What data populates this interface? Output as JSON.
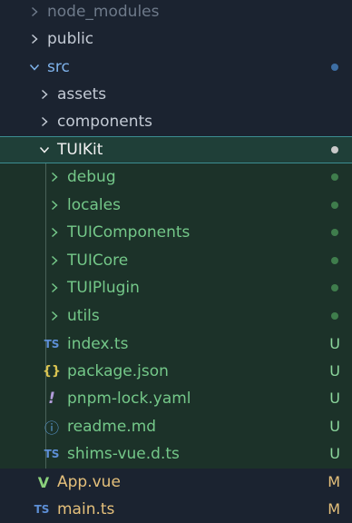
{
  "colors": {
    "background": "#1b2330",
    "modified_section_bg": "#1c3229",
    "selected_row_bg": "#1f3f38",
    "selection_border": "#3c8e92",
    "text_dim": "#6e7a8a",
    "text_normal": "#c3cad4",
    "text_blue": "#7fb3ec",
    "text_green": "#74c889",
    "text_white": "#f2f2f2",
    "dot_blue": "#3d6ea4",
    "dot_green": "#3f7d4c",
    "dot_white": "#c9c9c9",
    "ts_blue": "#5d8fd6",
    "json_yellow": "#d9c451",
    "yaml_purple": "#b19cd9",
    "info_blue": "#5b9bd5",
    "vue_green": "#8bd17c",
    "badge_u": "#8cd79d",
    "badge_m": "#e5c07b"
  },
  "explorer": {
    "items": [
      {
        "label": "node_modules",
        "kind": "folder",
        "expanded": false
      },
      {
        "label": "public",
        "kind": "folder",
        "expanded": false
      },
      {
        "label": "src",
        "kind": "folder",
        "expanded": true,
        "status": "dot"
      },
      {
        "label": "assets",
        "kind": "folder",
        "expanded": false
      },
      {
        "label": "components",
        "kind": "folder",
        "expanded": false
      },
      {
        "label": "TUIKit",
        "kind": "folder",
        "expanded": true,
        "selected": true,
        "status": "dot"
      },
      {
        "label": "debug",
        "kind": "folder",
        "expanded": false,
        "status": "dot"
      },
      {
        "label": "locales",
        "kind": "folder",
        "expanded": false,
        "status": "dot"
      },
      {
        "label": "TUIComponents",
        "kind": "folder",
        "expanded": false,
        "status": "dot"
      },
      {
        "label": "TUICore",
        "kind": "folder",
        "expanded": false,
        "status": "dot"
      },
      {
        "label": "TUIPlugin",
        "kind": "folder",
        "expanded": false,
        "status": "dot"
      },
      {
        "label": "utils",
        "kind": "folder",
        "expanded": false,
        "status": "dot"
      },
      {
        "label": "index.ts",
        "kind": "file",
        "icon": "TS",
        "status": "U"
      },
      {
        "label": "package.json",
        "kind": "file",
        "icon": "{}",
        "status": "U"
      },
      {
        "label": "pnpm-lock.yaml",
        "kind": "file",
        "icon": "!",
        "status": "U"
      },
      {
        "label": "readme.md",
        "kind": "file",
        "icon": "ⓘ",
        "status": "U"
      },
      {
        "label": "shims-vue.d.ts",
        "kind": "file",
        "icon": "TS",
        "status": "U"
      },
      {
        "label": "App.vue",
        "kind": "file",
        "icon": "V",
        "status": "M"
      },
      {
        "label": "main.ts",
        "kind": "file",
        "icon": "TS",
        "status": "M"
      }
    ]
  }
}
